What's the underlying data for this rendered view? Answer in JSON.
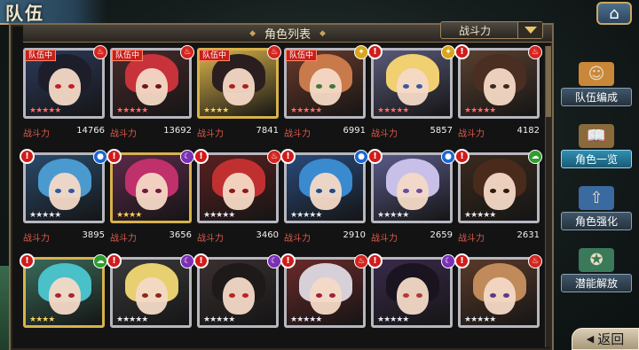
{
  "header": {
    "title": "队伍",
    "home_icon": "home-icon"
  },
  "panel": {
    "title": "角色列表",
    "sort_label": "战斗力"
  },
  "stat_label": "战斗力",
  "team_badge": "队伍中",
  "colors": {
    "fire": "#d4261f",
    "water": "#1d67d0",
    "dark": "#7a2fb5",
    "wind": "#2f9e2c",
    "light": "#d9a61a"
  },
  "cards": [
    {
      "in_team": true,
      "alert": false,
      "element": "fire",
      "stars": 5,
      "star_color": "red",
      "frame": "silver",
      "power": "14766",
      "hair": "#1d1e2a",
      "bg": "#2c3a5a",
      "eyes": "#c0202a"
    },
    {
      "in_team": true,
      "alert": false,
      "element": "fire",
      "stars": 5,
      "star_color": "red",
      "frame": "silver",
      "power": "13692",
      "hair": "#c8323a",
      "bg": "#4a2a2a",
      "eyes": "#6a1a1a"
    },
    {
      "in_team": true,
      "alert": false,
      "element": "fire",
      "stars": 4,
      "star_color": "gold",
      "frame": "gold",
      "power": "7841",
      "hair": "#2a1e1e",
      "bg": "#d8b24a",
      "eyes": "#b01e1e"
    },
    {
      "in_team": true,
      "alert": false,
      "element": "light",
      "stars": 5,
      "star_color": "red",
      "frame": "silver",
      "power": "6991",
      "hair": "#c97a4a",
      "bg": "#6a3a2a",
      "eyes": "#3a7a3a"
    },
    {
      "in_team": false,
      "alert": true,
      "element": "light",
      "stars": 5,
      "star_color": "red",
      "frame": "silver",
      "power": "5857",
      "hair": "#f0d070",
      "bg": "#5a5a7a",
      "eyes": "#3a5aa0"
    },
    {
      "in_team": false,
      "alert": true,
      "element": "fire",
      "stars": 5,
      "star_color": "red",
      "frame": "silver",
      "power": "4182",
      "hair": "#4a2e22",
      "bg": "#5a4030",
      "eyes": "#3a2a1a"
    },
    {
      "in_team": false,
      "alert": true,
      "element": "water",
      "stars": 5,
      "star_color": "silver",
      "frame": "silver",
      "power": "3895",
      "hair": "#4a9ad0",
      "bg": "#2a4a6a",
      "eyes": "#2a5aa0"
    },
    {
      "in_team": false,
      "alert": true,
      "element": "dark",
      "stars": 4,
      "star_color": "gold",
      "frame": "gold",
      "power": "3656",
      "hair": "#c0306a",
      "bg": "#5a2a4a",
      "eyes": "#6a1a3a"
    },
    {
      "in_team": false,
      "alert": true,
      "element": "fire",
      "stars": 5,
      "star_color": "silver",
      "frame": "silver",
      "power": "3460",
      "hair": "#c03030",
      "bg": "#5a2020",
      "eyes": "#8a1a1a"
    },
    {
      "in_team": false,
      "alert": true,
      "element": "water",
      "stars": 5,
      "star_color": "silver",
      "frame": "silver",
      "power": "2910",
      "hair": "#3a8ad0",
      "bg": "#2a4a7a",
      "eyes": "#1a4a8a"
    },
    {
      "in_team": false,
      "alert": true,
      "element": "water",
      "stars": 5,
      "star_color": "silver",
      "frame": "silver",
      "power": "2659",
      "hair": "#c8c0e8",
      "bg": "#5a5a8a",
      "eyes": "#6a4aa0"
    },
    {
      "in_team": false,
      "alert": true,
      "element": "wind",
      "stars": 5,
      "star_color": "silver",
      "frame": "silver",
      "power": "2631",
      "hair": "#4a2a1a",
      "bg": "#3a2a1e",
      "eyes": "#2a1a10"
    },
    {
      "in_team": false,
      "alert": true,
      "element": "wind",
      "stars": 4,
      "star_color": "gold",
      "frame": "gold",
      "power": "",
      "hair": "#4ac0c8",
      "bg": "#3a6a5a",
      "eyes": "#b02030"
    },
    {
      "in_team": false,
      "alert": true,
      "element": "dark",
      "stars": 5,
      "star_color": "silver",
      "frame": "silver",
      "power": "",
      "hair": "#e8d070",
      "bg": "#3a3a3a",
      "eyes": "#8a2a1a"
    },
    {
      "in_team": false,
      "alert": true,
      "element": "dark",
      "stars": 5,
      "star_color": "silver",
      "frame": "silver",
      "power": "",
      "hair": "#1e1a1a",
      "bg": "#3a3030",
      "eyes": "#c02020"
    },
    {
      "in_team": false,
      "alert": true,
      "element": "fire",
      "stars": 5,
      "star_color": "silver",
      "frame": "silver",
      "power": "",
      "hair": "#d8d0d8",
      "bg": "#6a2a2a",
      "eyes": "#a0203a"
    },
    {
      "in_team": false,
      "alert": true,
      "element": "dark",
      "stars": 5,
      "star_color": "silver",
      "frame": "silver",
      "power": "",
      "hair": "#1a1420",
      "bg": "#3a2a4a",
      "eyes": "#b03a3a"
    },
    {
      "in_team": false,
      "alert": true,
      "element": "fire",
      "stars": 5,
      "star_color": "silver",
      "frame": "silver",
      "power": "",
      "hair": "#c08a5a",
      "bg": "#5a3a2a",
      "eyes": "#5a3a8a"
    }
  ],
  "side_menu": [
    {
      "label": "队伍编成",
      "icon": "team-icon",
      "active": false
    },
    {
      "label": "角色一览",
      "icon": "book-icon",
      "active": true
    },
    {
      "label": "角色强化",
      "icon": "enhance-icon",
      "active": false
    },
    {
      "label": "潜能解放",
      "icon": "potential-icon",
      "active": false
    }
  ],
  "back": {
    "label": "返回"
  }
}
